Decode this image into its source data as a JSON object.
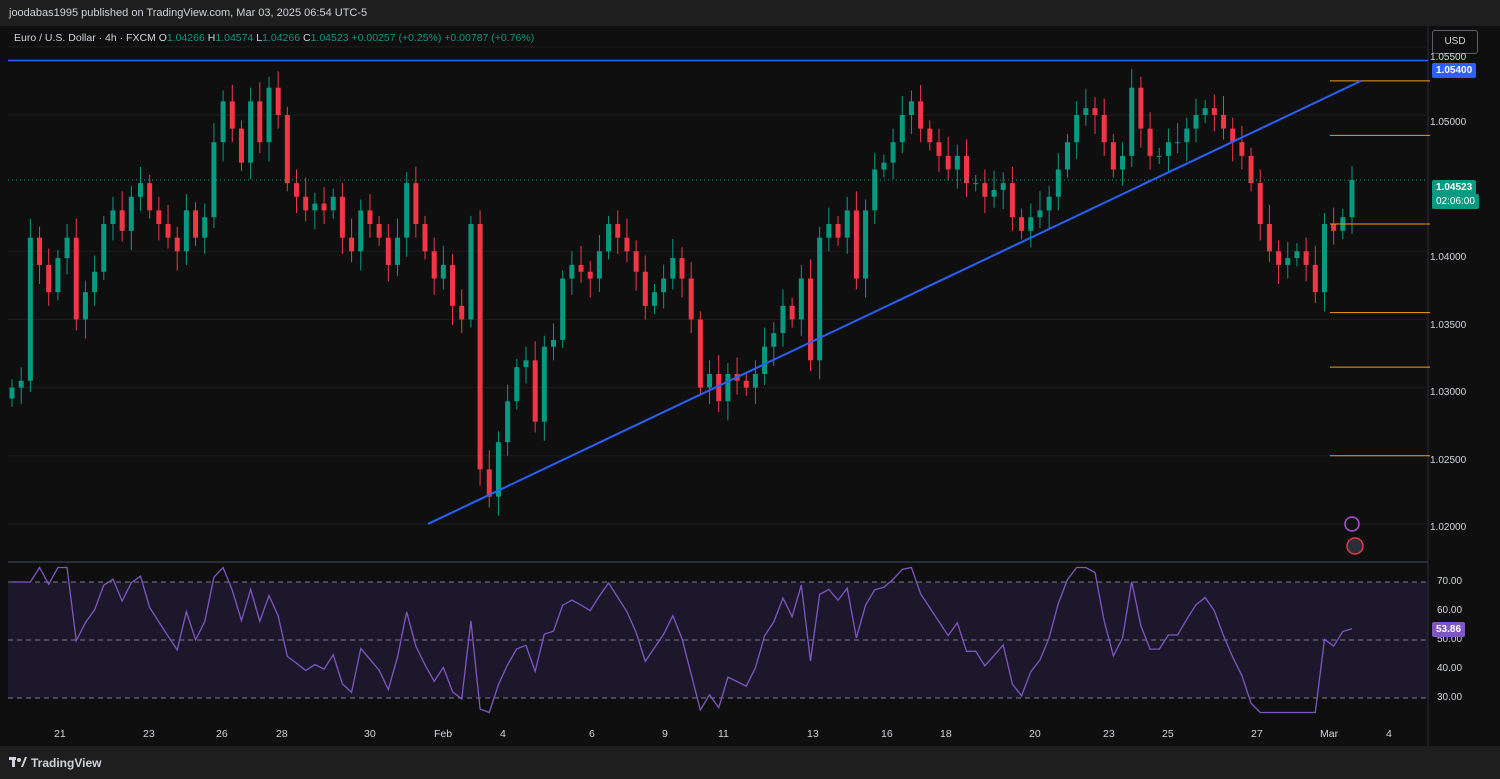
{
  "header": {
    "published_text": "joodabas1995 published on TradingView.com, Mar 03, 2025 06:54 UTC-5"
  },
  "symbol": {
    "name": "Euro / U.S. Dollar · 4h · FXCM",
    "open_label": "O",
    "open": "1.04266",
    "high_label": "H",
    "high": "1.04574",
    "low_label": "L",
    "low": "1.04266",
    "close_label": "C",
    "close": "1.04523",
    "change": "+0.00257 (+0.25%)",
    "change2": "+0.00787 (+0.76%)"
  },
  "currency_button": "USD",
  "price_axis": {
    "labels": [
      "1.05500",
      "1.05000",
      "1.04000",
      "1.03500",
      "1.03000",
      "1.02500",
      "1.02000"
    ],
    "resistance_tag": "1.05400",
    "current_price": "1.04523",
    "countdown": "02:06:00"
  },
  "rsi_axis": {
    "labels": [
      "70.00",
      "60.00",
      "50.00",
      "40.00",
      "30.00"
    ],
    "current": "53.86"
  },
  "date_axis": [
    "21",
    "23",
    "26",
    "28",
    "30",
    "Feb",
    "4",
    "6",
    "9",
    "11",
    "13",
    "16",
    "18",
    "20",
    "23",
    "25",
    "27",
    "Mar",
    "4"
  ],
  "footer": {
    "brand": "TradingView"
  },
  "colors": {
    "bull": "#089981",
    "bear": "#f23645",
    "trendline": "#2962ff",
    "fib": "#f59c1a",
    "rsi_line": "#7e57c2",
    "rsi_band": "#2a1f45"
  },
  "chart_data": {
    "type": "candlestick",
    "price_range": [
      1.0175,
      1.0555
    ],
    "ohlc_close_approx": [
      1.03,
      1.0305,
      1.041,
      1.039,
      1.037,
      1.0395,
      1.041,
      1.035,
      1.037,
      1.0385,
      1.042,
      1.043,
      1.0415,
      1.044,
      1.045,
      1.043,
      1.042,
      1.041,
      1.04,
      1.043,
      1.041,
      1.0425,
      1.048,
      1.051,
      1.049,
      1.0465,
      1.051,
      1.048,
      1.052,
      1.05,
      1.045,
      1.044,
      1.043,
      1.0435,
      1.043,
      1.044,
      1.041,
      1.04,
      1.043,
      1.042,
      1.041,
      1.039,
      1.041,
      1.045,
      1.042,
      1.04,
      1.038,
      1.039,
      1.036,
      1.035,
      1.042,
      1.024,
      1.022,
      1.026,
      1.029,
      1.0315,
      1.032,
      1.0275,
      1.033,
      1.0335,
      1.038,
      1.039,
      1.0385,
      1.038,
      1.04,
      1.042,
      1.041,
      1.04,
      1.0385,
      1.036,
      1.037,
      1.038,
      1.0395,
      1.038,
      1.035,
      1.03,
      1.031,
      1.029,
      1.031,
      1.0305,
      1.03,
      1.031,
      1.033,
      1.034,
      1.036,
      1.035,
      1.038,
      1.032,
      1.041,
      1.042,
      1.041,
      1.043,
      1.038,
      1.043,
      1.046,
      1.0465,
      1.048,
      1.05,
      1.051,
      1.049,
      1.048,
      1.047,
      1.046,
      1.047,
      1.045,
      1.045,
      1.044,
      1.0445,
      1.045,
      1.0425,
      1.0415,
      1.0425,
      1.043,
      1.044,
      1.046,
      1.048,
      1.05,
      1.0505,
      1.05,
      1.048,
      1.046,
      1.047,
      1.052,
      1.049,
      1.047,
      1.047,
      1.048,
      1.048,
      1.049,
      1.05,
      1.0505,
      1.05,
      1.049,
      1.048,
      1.047,
      1.045,
      1.042,
      1.04,
      1.039,
      1.0395,
      1.04,
      1.039,
      1.037,
      1.042,
      1.0415,
      1.0425,
      1.04523
    ],
    "horizontal_levels": [
      1.054,
      1.0525,
      1.0485,
      1.042,
      1.0355,
      1.0315,
      1.025
    ],
    "trendline": {
      "from_price": 1.02,
      "to_price": 1.0525
    },
    "rsi_levels": [
      70,
      50,
      30
    ],
    "rsi_last": 53.86
  }
}
